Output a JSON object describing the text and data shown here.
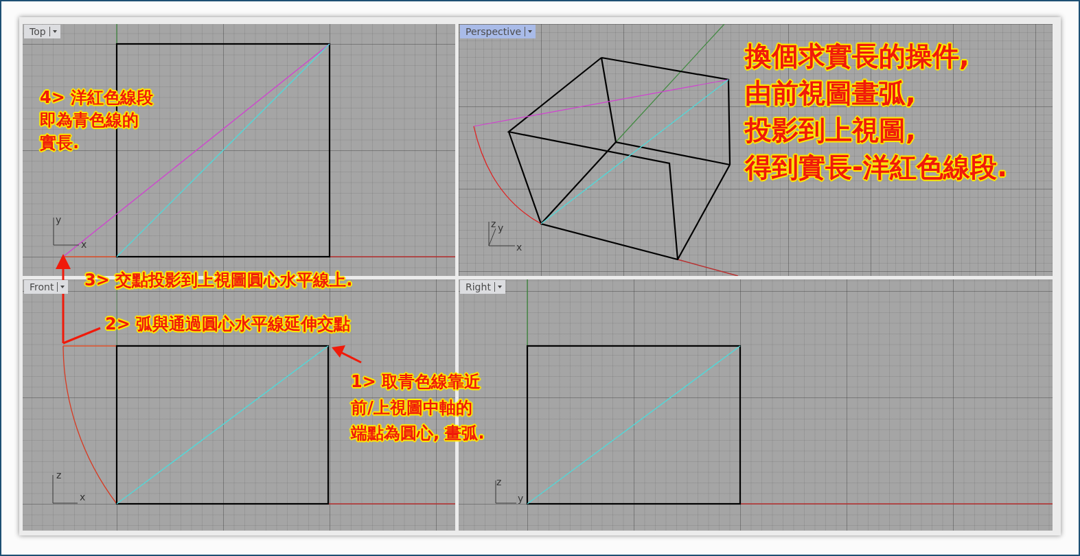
{
  "viewports": [
    {
      "kind": "top",
      "title": "Top",
      "selected": false,
      "axes": [
        "y",
        "x"
      ]
    },
    {
      "kind": "perspective",
      "title": "Perspective",
      "selected": true,
      "axes": [
        "z",
        "y",
        "x"
      ]
    },
    {
      "kind": "front",
      "title": "Front",
      "selected": false,
      "axes": [
        "z",
        "x"
      ]
    },
    {
      "kind": "right",
      "title": "Right",
      "selected": false,
      "axes": [
        "z",
        "y"
      ]
    }
  ],
  "annotations": [
    {
      "kind": "step4",
      "lines": [
        "4> 洋紅色線段",
        "即為青色線的",
        "實長."
      ]
    },
    {
      "kind": "summary",
      "lines": [
        "換個求實長的操件,",
        "由前視圖畫弧,",
        "投影到上視圖,",
        "得到實長-洋紅色線段."
      ]
    },
    {
      "kind": "step3",
      "lines": [
        "3> 交點投影到上視圖圓心水平線上."
      ]
    },
    {
      "kind": "step2",
      "lines": [
        "2> 弧與通過圓心水平線延伸交點"
      ]
    },
    {
      "kind": "step1",
      "lines": [
        "1> 取青色線靠近",
        "前/上視圖中軸的",
        "端點為圓心, 畫弧."
      ]
    }
  ]
}
